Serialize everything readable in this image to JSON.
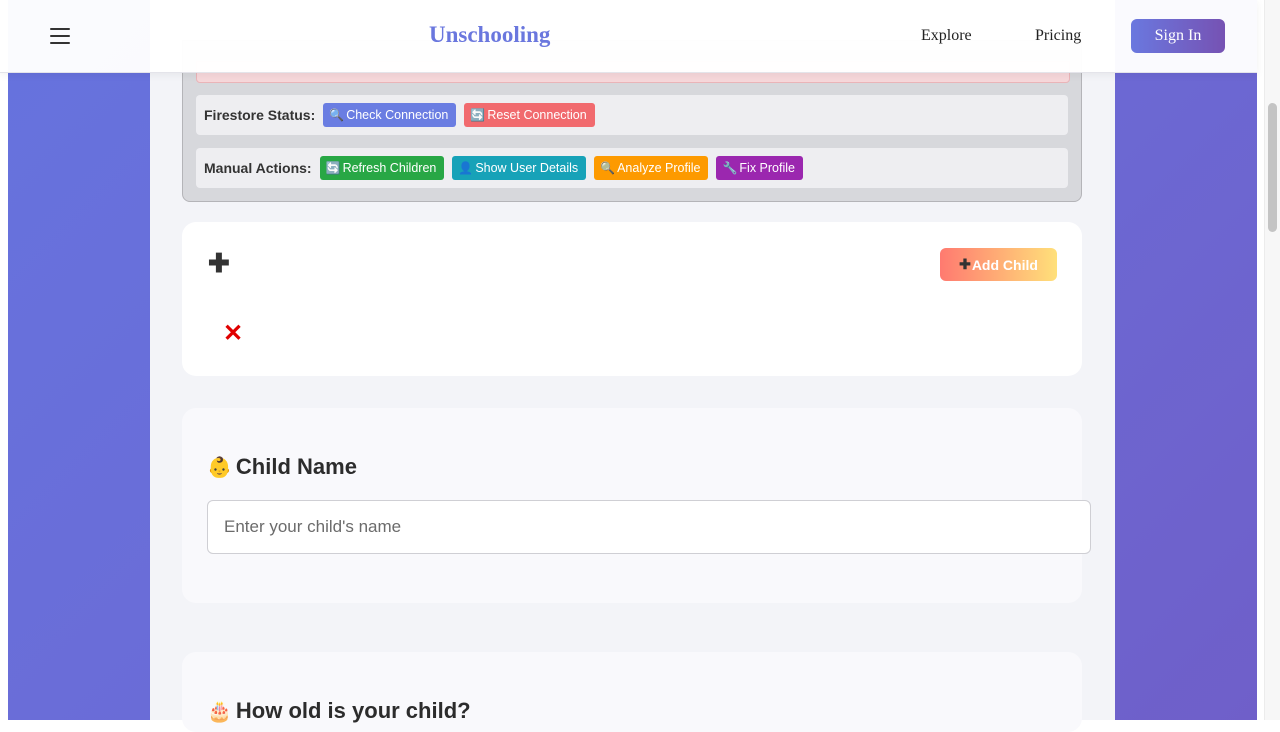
{
  "header": {
    "brand": "Unschooling",
    "nav": [
      "Explore",
      "Pricing"
    ],
    "sign_in": "Sign In"
  },
  "debug": {
    "firestore_label": "Firestore Status:",
    "firestore_buttons": [
      {
        "icon": "🔍",
        "label": "Check Connection",
        "color": "#6a7de2"
      },
      {
        "icon": "🔄",
        "label": "Reset Connection",
        "color": "#f16a6e"
      }
    ],
    "manual_label": "Manual Actions:",
    "manual_buttons": [
      {
        "icon": "🔄",
        "label": "Refresh Children",
        "color": "#28a745"
      },
      {
        "icon": "👤",
        "label": "Show User Details",
        "color": "#17a2b8"
      },
      {
        "icon": "🔍",
        "label": "Analyze Profile",
        "color": "#fd9a00"
      },
      {
        "icon": "🔧",
        "label": "Fix Profile",
        "color": "#9b27af"
      }
    ]
  },
  "add_child": {
    "plus_icon": "✚",
    "button_icon": "✚",
    "button_label": "Add Child",
    "error_icon": "✕"
  },
  "child_name": {
    "emoji": "👶",
    "title": "Child Name",
    "placeholder": "Enter your child's name"
  },
  "child_age": {
    "emoji": "🎂",
    "title": "How old is your child?"
  }
}
